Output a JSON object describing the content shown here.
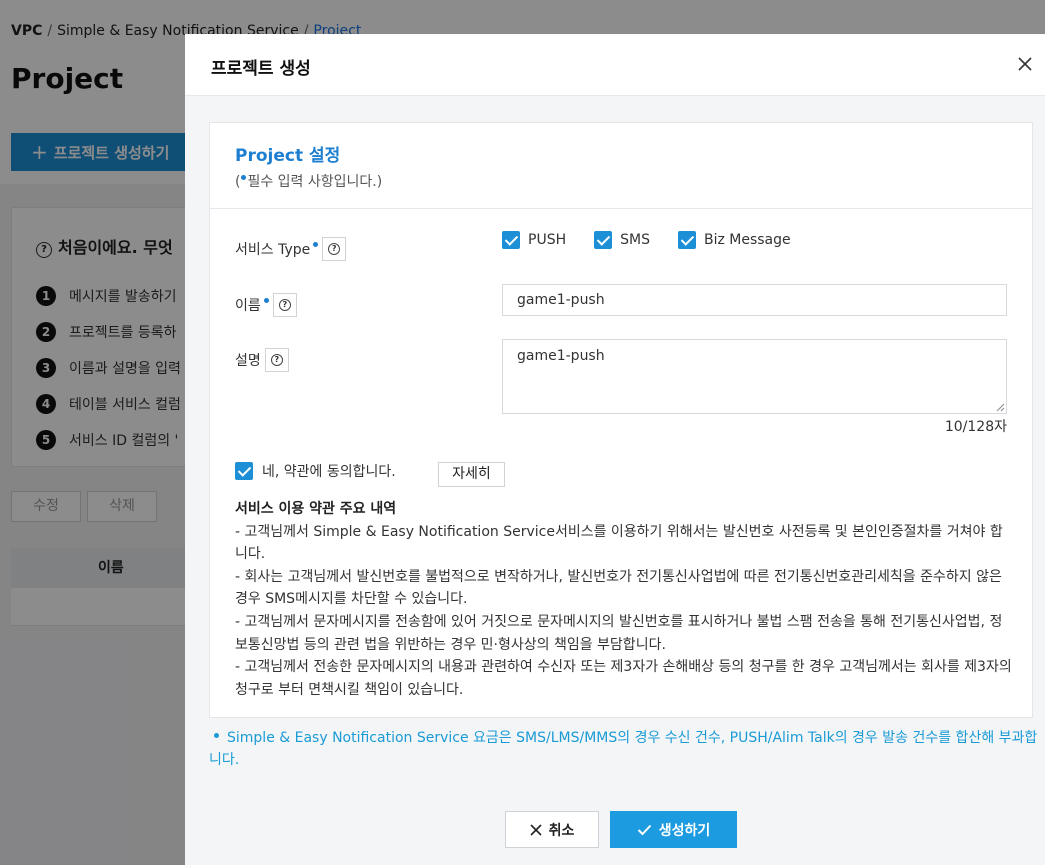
{
  "background": {
    "breadcrumb": {
      "root": "VPC",
      "service": "Simple & Easy Notification Service",
      "current": "Project"
    },
    "page_title": "Project",
    "create_button": "프로젝트 생성하기",
    "guide_title": "처음이에요. 무엇",
    "steps": [
      {
        "num": "1",
        "text": "메시지를 발송하기"
      },
      {
        "num": "2",
        "text": "프로젝트를 등록하"
      },
      {
        "num": "3",
        "text": "이름과 설명을 입력"
      },
      {
        "num": "4",
        "text": "테이블 서비스 컬럼"
      },
      {
        "num": "5",
        "text": "서비스 ID 컬럼의 '"
      }
    ],
    "edit_button": "수정",
    "delete_button": "삭제",
    "table_header_name": "이름"
  },
  "modal": {
    "title": "프로젝트 생성",
    "section_title": "Project 설정",
    "required_prefix": "(",
    "required_note": "필수 입력 사항입니다.)",
    "service_type_label": "서비스 Type",
    "service_types": [
      "PUSH",
      "SMS",
      "Biz Message"
    ],
    "name_label": "이름",
    "name_value": "game1-push",
    "desc_label": "설명",
    "desc_value": "game1-push",
    "char_count": "10/128자",
    "agree_label": "네, 약관에 동의합니다.",
    "detail_button": "자세히",
    "terms_title": "서비스 이용 약관 주요 내역",
    "terms": [
      "- 고객님께서 Simple & Easy Notification Service서비스를 이용하기 위해서는 발신번호 사전등록 및 본인인증절차를 거쳐야 합니다.",
      "- 회사는 고객님께서 발신번호를 불법적으로 변작하거나, 발신번호가 전기통신사업법에 따른 전기통신번호관리세칙을 준수하지 않은 경우 SMS메시지를 차단할 수 있습니다.",
      "- 고객님께서 문자메시지를 전송함에 있어 거짓으로 문자메시지의 발신번호를 표시하거나 불법 스팸 전송을 통해 전기통신사업법, 정보통신망법 등의 관련 법을 위반하는 경우 민·형사상의 책임을 부담합니다.",
      "- 고객님께서 전송한 문자메시지의 내용과 관련하여 수신자 또는 제3자가 손해배상 등의 청구를 한 경우 고객님께서는 회사를 제3자의 청구로 부터 면책시킬 책임이 있습니다."
    ],
    "pricing_notice": "Simple & Easy Notification Service 요금은 SMS/LMS/MMS의 경우 수신 건수, PUSH/Alim Talk의 경우 발송 건수를 합산해 부과합니다.",
    "cancel_button": "취소",
    "create_button": "생성하기"
  },
  "colors": {
    "accent": "#1d8fd6",
    "title_blue": "#1d7fd0",
    "notice_blue": "#1a9bd6"
  }
}
